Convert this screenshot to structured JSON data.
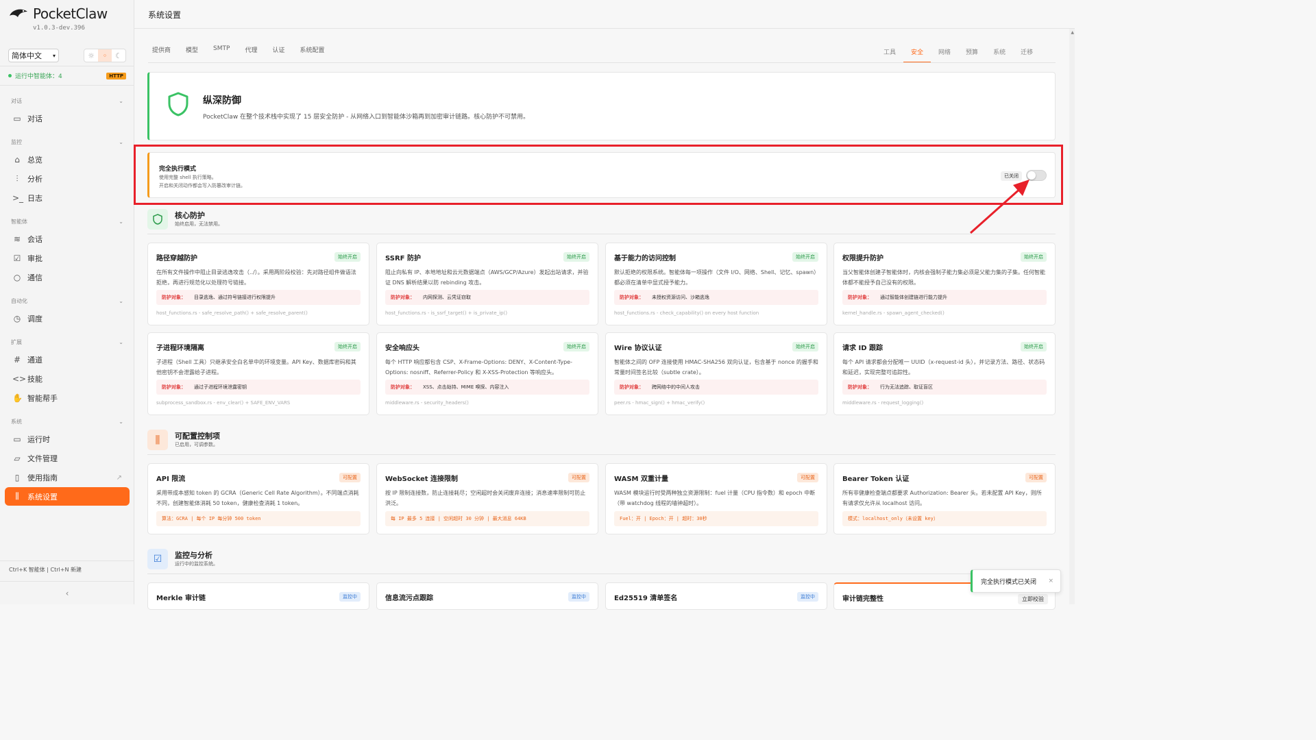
{
  "app": {
    "name": "PocketClaw",
    "version": "v1.0.3-dev.396"
  },
  "sidebar": {
    "language": "简体中文",
    "status_text": "运行中智能体：4",
    "http_badge": "HTTP",
    "groups": {
      "chat": "对话",
      "monitor": "监控",
      "agents": "智能体",
      "automation": "自动化",
      "extensions": "扩展",
      "system": "系统"
    },
    "items": {
      "chat": "对话",
      "overview": "总览",
      "analytics": "分析",
      "logs": "日志",
      "sessions": "会话",
      "approvals": "审批",
      "comms": "通信",
      "schedule": "调度",
      "channels": "通道",
      "skills": "技能",
      "assistant": "智能帮手",
      "runtime": "运行时",
      "files": "文件管理",
      "guide": "使用指南",
      "settings": "系统设置"
    },
    "shortcut": "Ctrl+K 智能体 | Ctrl+N 新建"
  },
  "header": {
    "title": "系统设置"
  },
  "tabs_left": [
    "提供商",
    "模型",
    "SMTP",
    "代理",
    "认证",
    "系统配置"
  ],
  "tabs_right": [
    "工具",
    "安全",
    "网络",
    "预算",
    "系统",
    "迁移"
  ],
  "hero": {
    "title": "纵深防御",
    "desc": "PocketClaw 在整个技术栈中实现了 15 层安全防护 - 从网络入口到智能体沙箱再到加密审计链路。核心防护不可禁用。"
  },
  "full_exec": {
    "title": "完全执行模式",
    "desc1": "使用完整 shell 执行策略。",
    "desc2": "开启和关闭动作都会写入防篡改审计链。",
    "state": "已关闭"
  },
  "core": {
    "title": "核心防护",
    "subtitle": "始终启用，无法禁用。",
    "badge": "始终开启",
    "threat_label": "防护对象：",
    "cards": [
      {
        "title": "路径穿越防护",
        "desc": "在所有文件操作中阻止目录逃逸攻击（../）。采用两阶段校验：先对路径组件做语法拒绝，再进行规范化以处理符号链接。",
        "threat": "目录逃逸、通过符号链接进行权限提升",
        "src": "host_functions.rs - safe_resolve_path() + safe_resolve_parent()"
      },
      {
        "title": "SSRF 防护",
        "desc": "阻止向私有 IP、本地地址和云元数据端点（AWS/GCP/Azure）发起出站请求，并验证 DNS 解析结果以防 rebinding 攻击。",
        "threat": "内网探测、云凭证窃取",
        "src": "host_functions.rs - is_ssrf_target() + is_private_ip()"
      },
      {
        "title": "基于能力的访问控制",
        "desc": "默认拒绝的权限系统。智能体每一项操作（文件 I/O、网络、Shell、记忆、spawn）都必须在清单中显式授予能力。",
        "threat": "未授权资源访问、沙箱逃逸",
        "src": "host_functions.rs - check_capability() on every host function"
      },
      {
        "title": "权限提升防护",
        "desc": "当父智能体创建子智能体时，内核会强制子能力集必须是父能力集的子集。任何智能体都不能授予自己没有的权限。",
        "threat": "通过智能体创建链进行能力提升",
        "src": "kernel_handle.rs - spawn_agent_checked()"
      },
      {
        "title": "子进程环境隔离",
        "desc": "子进程（Shell 工具）只继承安全白名单中的环境变量。API Key、数据库密码和其他密钥不会泄露给子进程。",
        "threat": "通过子进程环境泄露密钥",
        "src": "subprocess_sandbox.rs - env_clear() + SAFE_ENV_VARS"
      },
      {
        "title": "安全响应头",
        "desc": "每个 HTTP 响应都包含 CSP、X-Frame-Options: DENY、X-Content-Type-Options: nosniff、Referrer-Policy 和 X-XSS-Protection 等响应头。",
        "threat": "XSS、点击劫持、MIME 嗅探、内容注入",
        "src": "middleware.rs - security_headers()"
      },
      {
        "title": "Wire 协议认证",
        "desc": "智能体之间的 OFP 连接使用 HMAC-SHA256 双向认证，包含基于 nonce 的握手和常量时间签名比较（subtle crate）。",
        "threat": "跨网络中的中间人攻击",
        "src": "peer.rs - hmac_sign() + hmac_verify()"
      },
      {
        "title": "请求 ID 跟踪",
        "desc": "每个 API 请求都会分配唯一 UUID（x-request-id 头），并记录方法、路径、状态码和延迟，实现完整可追踪性。",
        "threat": "行为无法追踪、取证盲区",
        "src": "middleware.rs - request_logging()"
      }
    ]
  },
  "configurable": {
    "title": "可配置控制项",
    "subtitle": "已启用，可调参数。",
    "badge": "可配置",
    "cards": [
      {
        "title": "API 限流",
        "desc": "采用带成本感知 token 的 GCRA（Generic Cell Rate Algorithm）。不同端点消耗不同，创建智能体消耗 50 token，健康检查消耗 1 token。",
        "value": "算法：GCRA | 每个 IP 每分钟 500 token"
      },
      {
        "title": "WebSocket 连接限制",
        "desc": "按 IP 限制连接数，防止连接耗尽；空闲超时会关闭废弃连接；消息速率限制可防止洪泛。",
        "value": "每 IP 最多 5 连接 | 空闲超时 30 分钟 | 最大消息 64KB"
      },
      {
        "title": "WASM 双重计量",
        "desc": "WASM 模块运行时受两种独立资源限制：fuel 计量（CPU 指令数）和 epoch 中断（带 watchdog 线程的墙钟超时）。",
        "value": "Fuel：开 | Epoch：开 | 超时：30秒"
      },
      {
        "title": "Bearer Token 认证",
        "desc": "所有非健康检查端点都要求 Authorization: Bearer 头。若未配置 API Key，则所有请求仅允许从 localhost 访问。",
        "value": "模式：localhost_only（未设置 key）"
      }
    ]
  },
  "monitoring": {
    "title": "监控与分析",
    "subtitle": "运行中的监控系统。",
    "badge": "监控中",
    "cards": [
      {
        "title": "Merkle 审计链"
      },
      {
        "title": "信息流污点跟踪"
      },
      {
        "title": "Ed25519 清单签名"
      },
      {
        "title": "审计链完整性",
        "action": "立即校验"
      }
    ]
  },
  "toast": {
    "text": "完全执行模式已关闭",
    "close": "×"
  },
  "colors": {
    "accent": "#ff6a1a",
    "success": "#3ac264",
    "warning": "#f59b1b",
    "danger": "#e8202a",
    "info": "#3a7bd5"
  }
}
